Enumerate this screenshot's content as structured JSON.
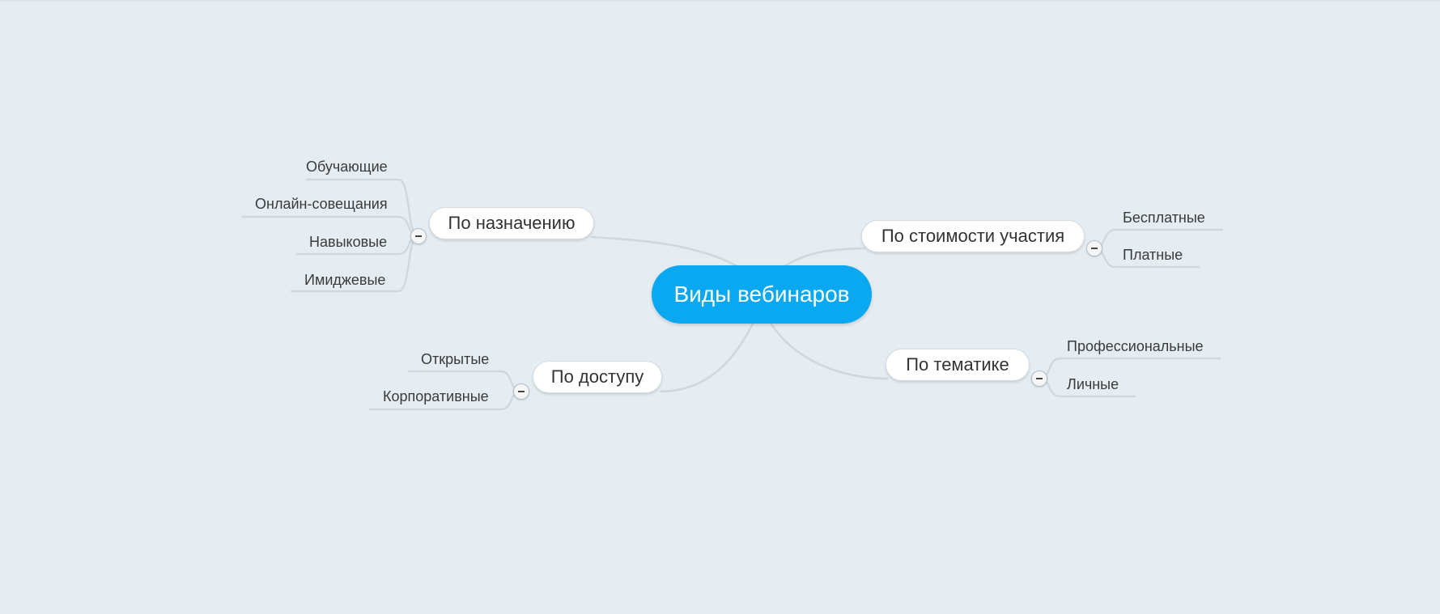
{
  "mindmap": {
    "root": "Виды вебинаров",
    "branches": [
      {
        "label": "По назначению",
        "toggle": "−",
        "children": [
          "Обучающие",
          "Онлайн-совещания",
          "Навыковые",
          "Имиджевые"
        ]
      },
      {
        "label": "По доступу",
        "toggle": "−",
        "children": [
          "Открытые",
          "Корпоративные"
        ]
      },
      {
        "label": "По стоимости участия",
        "toggle": "−",
        "children": [
          "Бесплатные",
          "Платные"
        ]
      },
      {
        "label": "По тематике",
        "toggle": "−",
        "children": [
          "Профессиональные",
          "Личные"
        ]
      }
    ],
    "colors": {
      "background": "#e5edf2",
      "root": "#0aa8f0",
      "connector": "#cfd8de"
    }
  }
}
